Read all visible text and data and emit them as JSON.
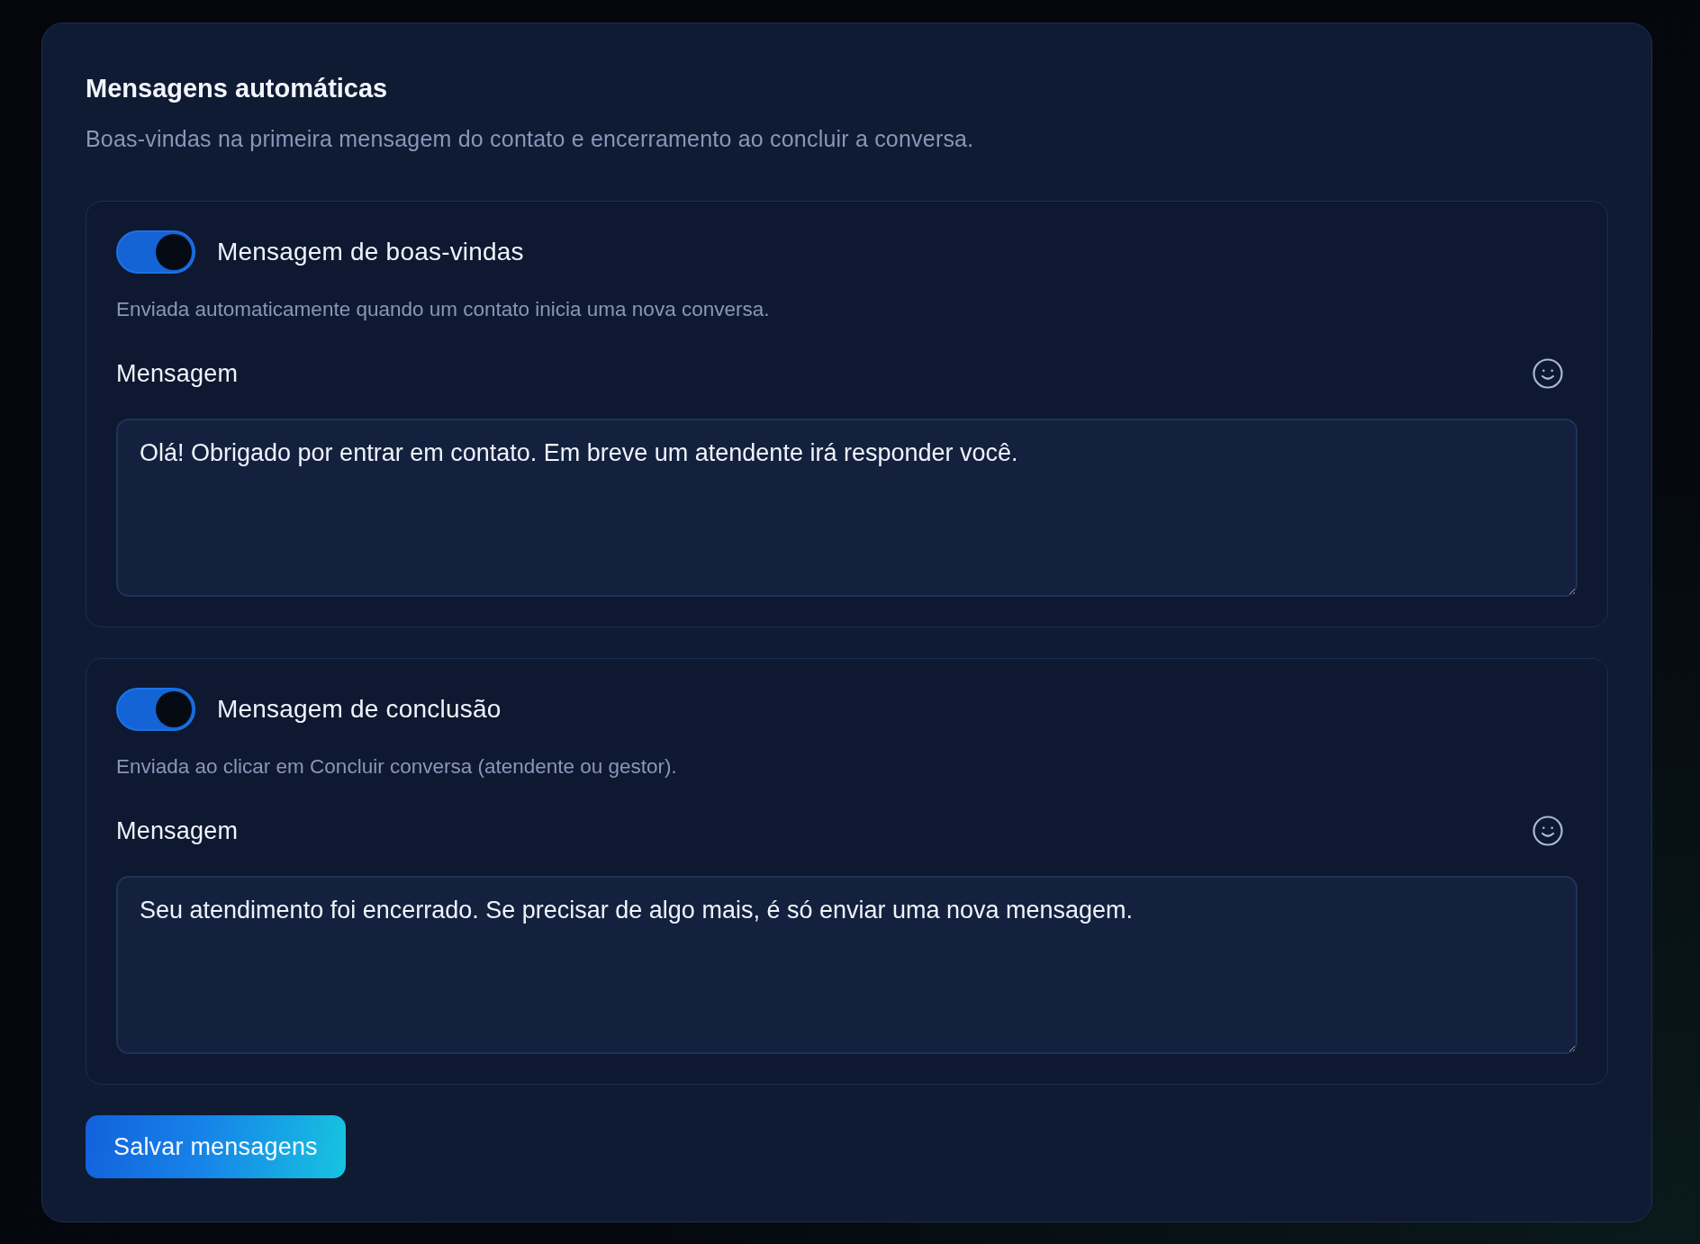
{
  "panel": {
    "title": "Mensagens automáticas",
    "subtitle": "Boas-vindas na primeira mensagem do contato e encerramento ao concluir a conversa."
  },
  "sections": [
    {
      "toggle": {
        "label": "Mensagem de boas-vindas",
        "on": true
      },
      "description": "Enviada automaticamente quando um contato inicia uma nova conversa.",
      "field_label": "Mensagem",
      "message": {
        "value": "Olá! Obrigado por entrar em contato. Em breve um atendente irá responder você."
      }
    },
    {
      "toggle": {
        "label": "Mensagem de conclusão",
        "on": true
      },
      "description": "Enviada ao clicar em Concluir conversa (atendente ou gestor).",
      "field_label": "Mensagem",
      "message": {
        "value": "Seu atendimento foi encerrado. Se precisar de algo mais, é só enviar uma nova mensagem."
      }
    }
  ],
  "save_button": {
    "label": "Salvar mensagens"
  }
}
